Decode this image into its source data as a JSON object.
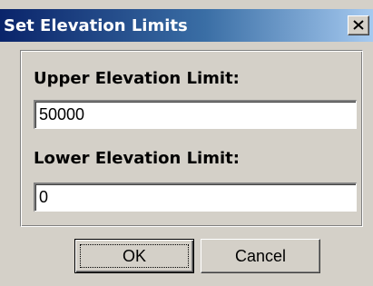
{
  "window": {
    "title": "Set Elevation Limits",
    "close_icon": "close-icon"
  },
  "form": {
    "upper_label": "Upper Elevation Limit:",
    "upper_value": "50000",
    "lower_label": "Lower Elevation Limit:",
    "lower_value": "0"
  },
  "buttons": {
    "ok_label": "OK",
    "cancel_label": "Cancel"
  },
  "colors": {
    "titlebar_start": "#0a246a",
    "titlebar_end": "#a6caf0",
    "face": "#d4d0c8"
  }
}
